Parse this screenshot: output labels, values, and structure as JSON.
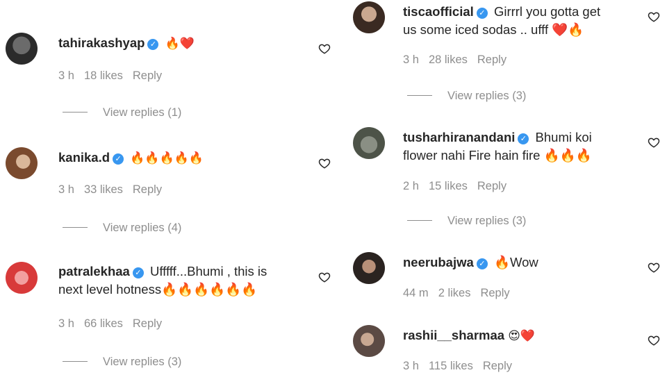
{
  "left_column": [
    {
      "username": "tahirakashyap",
      "text": "🔥❤️",
      "time": "3 h",
      "likes": "18 likes",
      "reply": "Reply",
      "view_replies": "View replies (1)"
    },
    {
      "username": "kanika.d",
      "text": "🔥🔥🔥🔥🔥",
      "time": "3 h",
      "likes": "33 likes",
      "reply": "Reply",
      "view_replies": "View replies (4)"
    },
    {
      "username": "patralekhaa",
      "text": "Ufffff...Bhumi , this is",
      "text_line2": "next level hotness🔥🔥🔥🔥🔥🔥",
      "time": "3 h",
      "likes": "66 likes",
      "reply": "Reply",
      "view_replies": "View replies (3)"
    }
  ],
  "right_column": [
    {
      "username": "tiscaofficial",
      "text": "Girrrl you gotta get",
      "text_line2": "us some iced sodas .. ufff ❤️🔥",
      "time": "3 h",
      "likes": "28 likes",
      "reply": "Reply",
      "view_replies": "View replies (3)"
    },
    {
      "username": "tusharhiranandani",
      "text": "Bhumi koi",
      "text_line2": "flower nahi Fire hain fire 🔥🔥🔥",
      "time": "2 h",
      "likes": "15 likes",
      "reply": "Reply",
      "view_replies": "View replies (3)"
    },
    {
      "username": "neerubajwa",
      "text": "🔥Wow",
      "time": "44 m",
      "likes": "2 likes",
      "reply": "Reply"
    },
    {
      "username": "rashii__sharmaa",
      "text": "😍❤️",
      "time": "3 h",
      "likes": "115 likes",
      "reply": "Reply"
    }
  ],
  "colors": {
    "text": "#262626",
    "muted": "#8e8e8e",
    "verified": "#3897f0"
  },
  "icons": {
    "verified": "verified-badge-icon",
    "like": "heart-outline-icon"
  }
}
